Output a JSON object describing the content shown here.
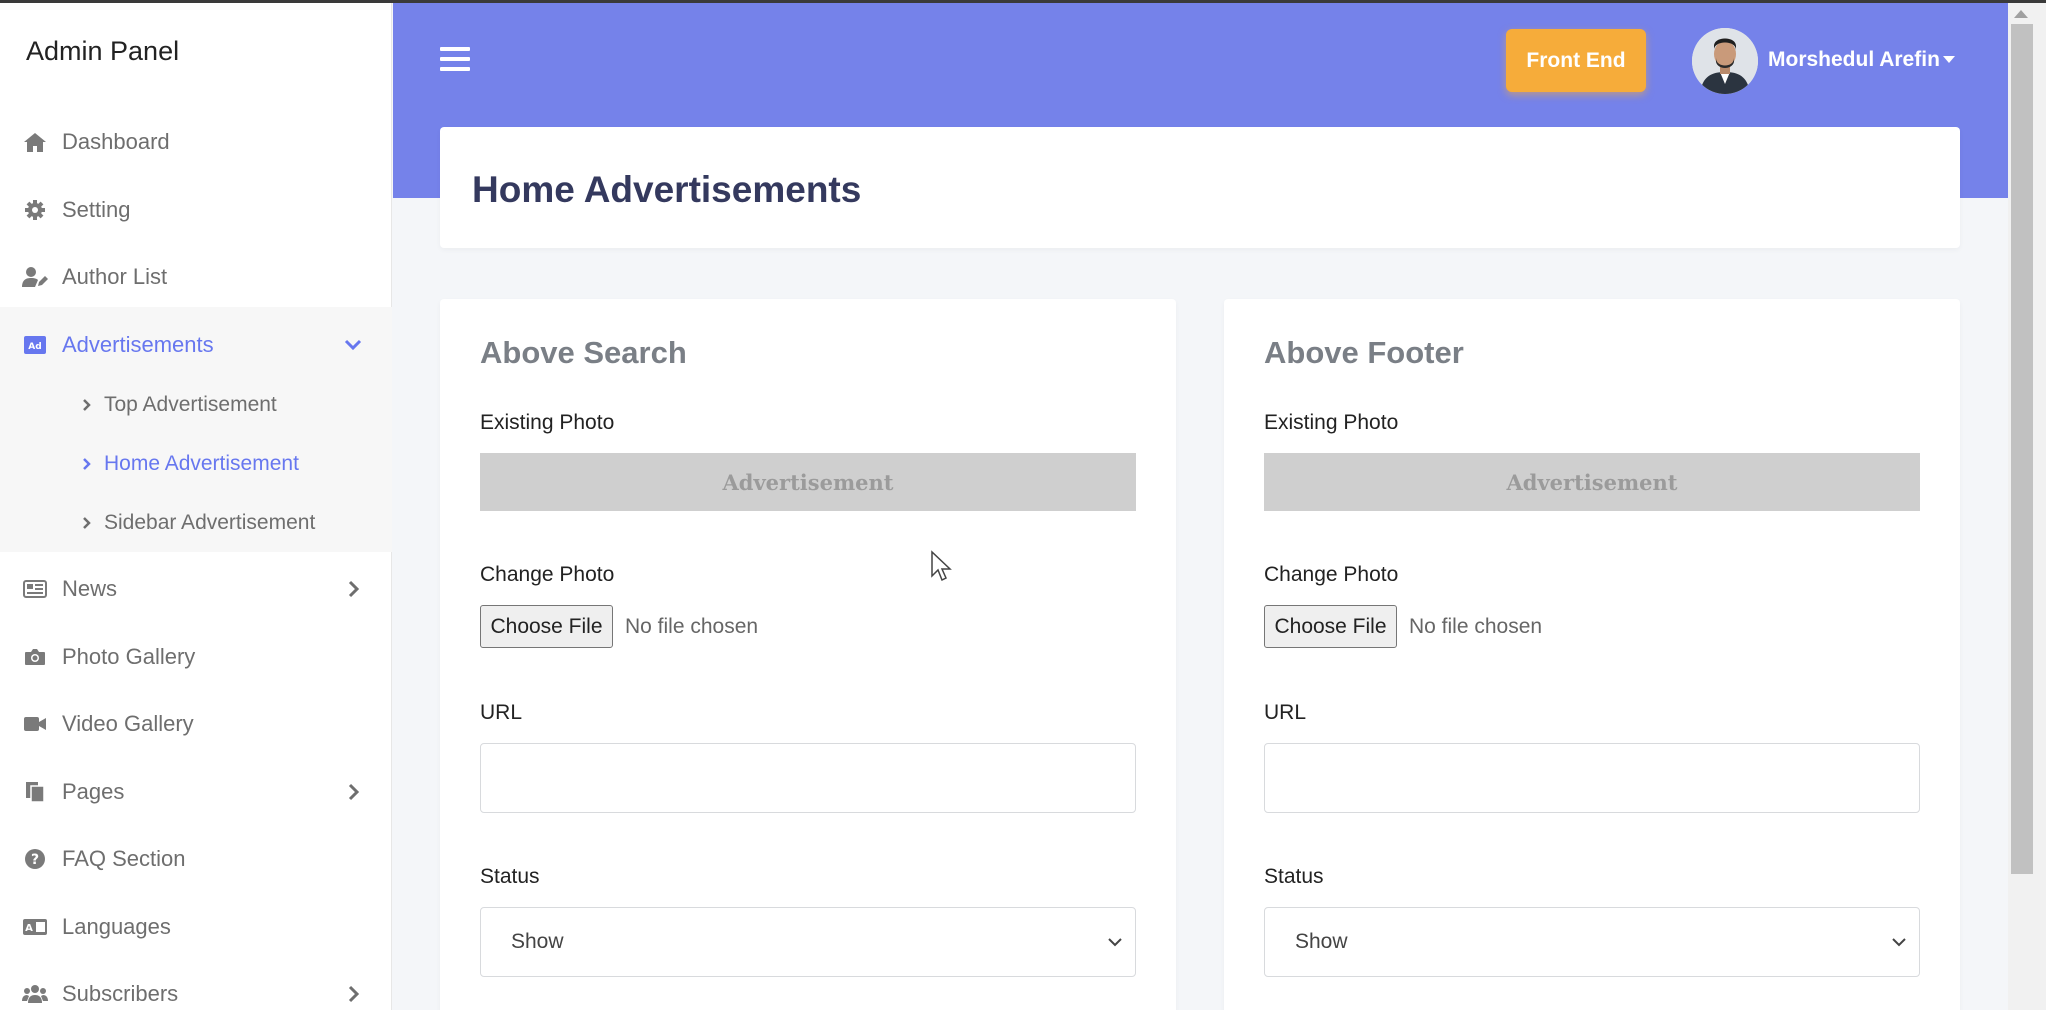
{
  "sidebar": {
    "brand": "Admin Panel",
    "items": [
      {
        "label": "Dashboard",
        "icon": "home-icon"
      },
      {
        "label": "Setting",
        "icon": "gear-icon"
      },
      {
        "label": "Author List",
        "icon": "user-edit-icon"
      },
      {
        "label": "Advertisements",
        "icon": "ad-icon",
        "active": true,
        "expanded": true
      },
      {
        "label": "News",
        "icon": "newspaper-icon"
      },
      {
        "label": "Photo Gallery",
        "icon": "camera-icon"
      },
      {
        "label": "Video Gallery",
        "icon": "video-icon"
      },
      {
        "label": "Pages",
        "icon": "pages-icon"
      },
      {
        "label": "FAQ Section",
        "icon": "question-circle-icon"
      },
      {
        "label": "Languages",
        "icon": "language-icon"
      },
      {
        "label": "Subscribers",
        "icon": "users-icon"
      }
    ],
    "sub_items": [
      {
        "label": "Top Advertisement"
      },
      {
        "label": "Home Advertisement",
        "active": true
      },
      {
        "label": "Sidebar Advertisement"
      }
    ]
  },
  "header": {
    "front_end_label": "Front End",
    "user_name": "Morshedul Arefin"
  },
  "main": {
    "page_title": "Home Advertisements",
    "cards": [
      {
        "title": "Above Search",
        "existing_photo_label": "Existing Photo",
        "ad_placeholder": "Advertisement",
        "change_photo_label": "Change Photo",
        "choose_file_label": "Choose File",
        "no_file_text": "No file chosen",
        "url_label": "URL",
        "url_value": "",
        "status_label": "Status",
        "status_value": "Show"
      },
      {
        "title": "Above Footer",
        "existing_photo_label": "Existing Photo",
        "ad_placeholder": "Advertisement",
        "change_photo_label": "Change Photo",
        "choose_file_label": "Choose File",
        "no_file_text": "No file chosen",
        "url_label": "URL",
        "url_value": "",
        "status_label": "Status",
        "status_value": "Show"
      }
    ]
  },
  "colors": {
    "header": "#7582ea",
    "accent": "#6777ef",
    "front_end_button": "#f6ac3a"
  }
}
